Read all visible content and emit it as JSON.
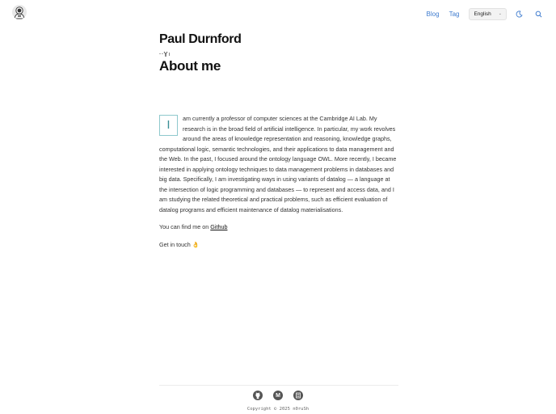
{
  "header": {
    "logo_icon": "astronaut-avatar-icon",
    "nav": [
      {
        "label": "Blog"
      },
      {
        "label": "Tag"
      }
    ],
    "language": {
      "selected": "English"
    },
    "theme_icon": "moon-icon",
    "search_icon": "search-icon"
  },
  "main": {
    "site_name": "Paul Durnford",
    "page_title": "About me",
    "dropcap": "I",
    "bio_text": "am currently a professor of computer sciences at the Cambridge AI Lab. My research is in the broad field of artificial intelligence. In particular, my work revolves around the areas of knowledge representation and reasoning, knowledge graphs, computational logic, semantic technologies, and their applications to data management and the Web. In the past, I focused around the ontology language OWL. More recently, I became interested in applying ontology techniques to data management problems in databases and big data. Specifically, I am investigating ways in using variants of datalog — a language at the intersection of logic programming and databases — to represent and access data, and I am studying the related theoretical and practical problems, such as efficient evaluation of datalog programs and efficient maintenance of datalog materialisations.",
    "find_me_prefix": "You can find me on ",
    "github_link": "Github",
    "get_in_touch": "Get in touch 👌"
  },
  "footer": {
    "socials": [
      {
        "icon": "github-icon"
      },
      {
        "icon": "medium-icon",
        "glyph": "M"
      },
      {
        "icon": "blog-icon"
      }
    ],
    "copyright": "Copyright © 2025 n0ruSh"
  },
  "colors": {
    "link": "#3f7ccf",
    "dropcap_border": "#8fc9cd",
    "heading": "#111111"
  }
}
